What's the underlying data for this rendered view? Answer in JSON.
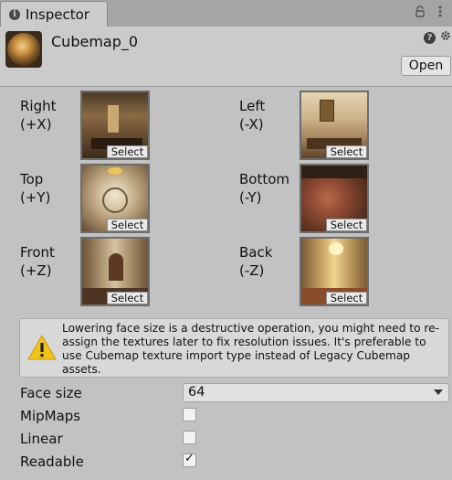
{
  "tab": {
    "title": "Inspector"
  },
  "header": {
    "asset_name": "Cubemap_0",
    "open_label": "Open",
    "help_glyph": "?"
  },
  "faces": [
    {
      "label": "Right\n(+X)",
      "select": "Select"
    },
    {
      "label": "Left\n(-X)",
      "select": "Select"
    },
    {
      "label": "Top\n(+Y)",
      "select": "Select"
    },
    {
      "label": "Bottom\n(-Y)",
      "select": "Select"
    },
    {
      "label": "Front\n(+Z)",
      "select": "Select"
    },
    {
      "label": "Back\n(-Z)",
      "select": "Select"
    }
  ],
  "warning": {
    "text": "Lowering face size is a destructive operation, you might need to re-assign the textures later to fix resolution issues. It's preferable to use Cubemap texture import type instead of Legacy Cubemap assets."
  },
  "properties": {
    "face_size_label": "Face size",
    "face_size_value": "64",
    "mipmaps_label": "MipMaps",
    "mipmaps_checked": false,
    "linear_label": "Linear",
    "linear_checked": false,
    "readable_label": "Readable",
    "readable_checked": true,
    "check_glyph": "✓"
  },
  "colors": {
    "warning_yellow": "#f0c419",
    "background": "#c2c2c2"
  }
}
